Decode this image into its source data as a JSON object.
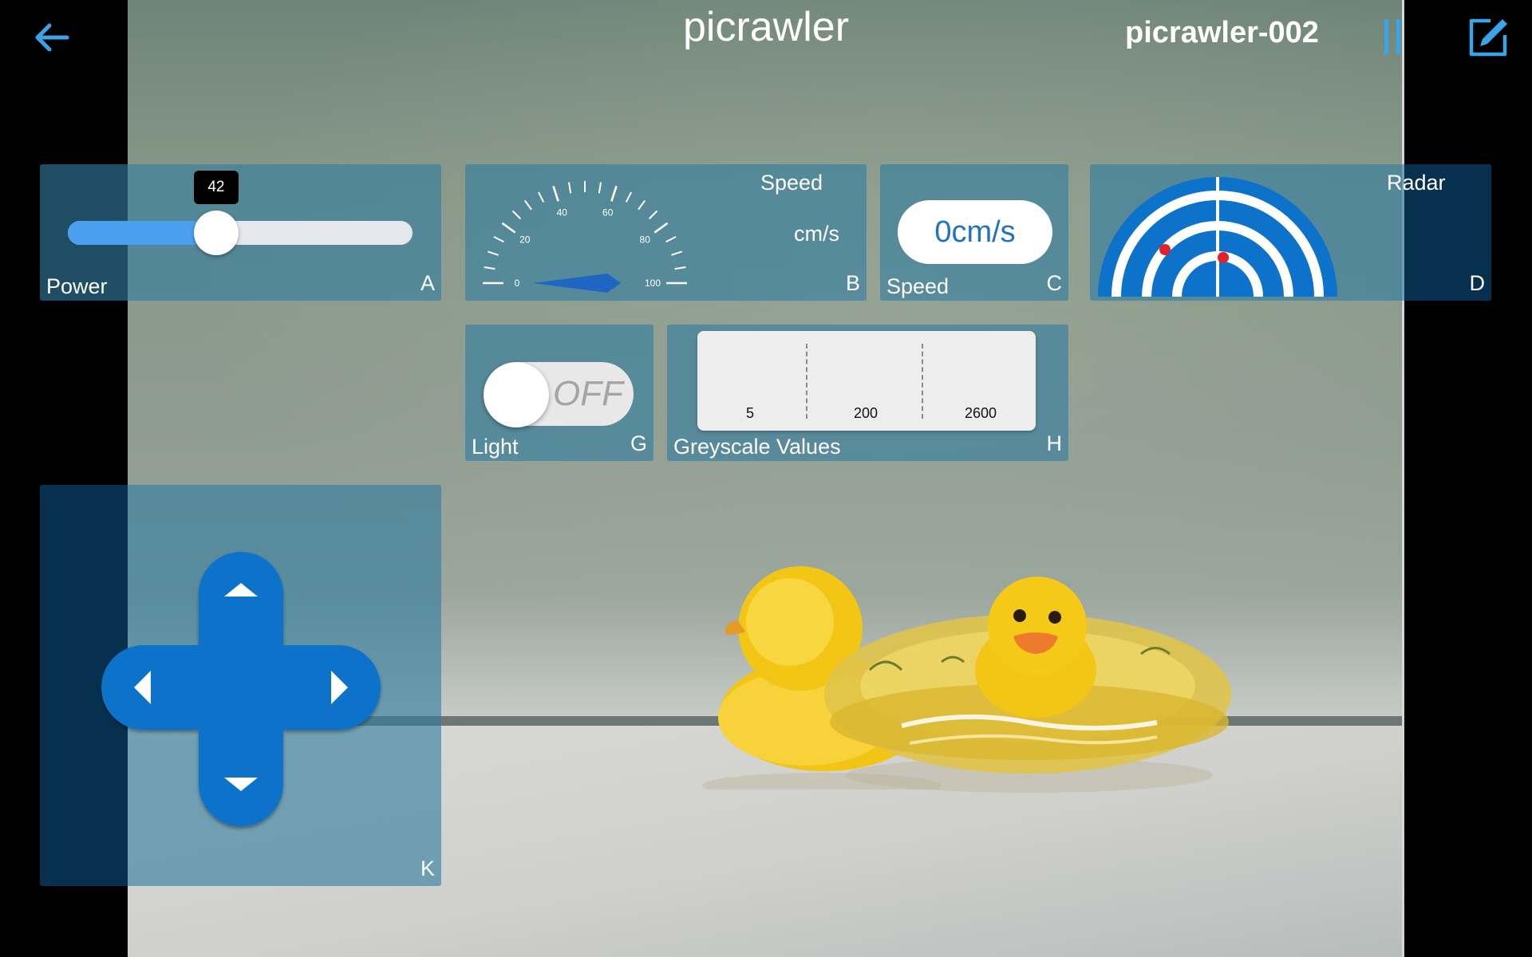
{
  "header": {
    "title": "picrawler",
    "device_name": "picrawler-002"
  },
  "colors": {
    "accent": "#3aa4e8",
    "panel": "#327da0",
    "control_blue": "#0d72c9",
    "radar_dot": "#e0232a"
  },
  "widgets": {
    "power_slider": {
      "label": "Power",
      "key": "A",
      "value": 42,
      "tooltip": "42",
      "max": 100
    },
    "speed_gauge": {
      "title": "Speed",
      "unit": "cm/s",
      "key": "B",
      "tick_labels": [
        "0",
        "20",
        "40",
        "60",
        "80",
        "100"
      ],
      "value": 0
    },
    "speed_display": {
      "label": "Speed",
      "key": "C",
      "value_text": "0cm/s"
    },
    "radar": {
      "label": "Radar",
      "key": "D"
    },
    "light_switch": {
      "label": "Light",
      "key": "G",
      "state": "OFF"
    },
    "greyscale": {
      "label": "Greyscale Values",
      "key": "H",
      "values": [
        "5",
        "200",
        "2600"
      ]
    },
    "dpad": {
      "key": "K"
    }
  },
  "icons": {
    "back": "arrow-left-icon",
    "pause": "pause-icon",
    "edit": "edit-icon",
    "dpad_up": "triangle-up-icon",
    "dpad_down": "triangle-down-icon",
    "dpad_left": "triangle-left-icon",
    "dpad_right": "triangle-right-icon"
  }
}
